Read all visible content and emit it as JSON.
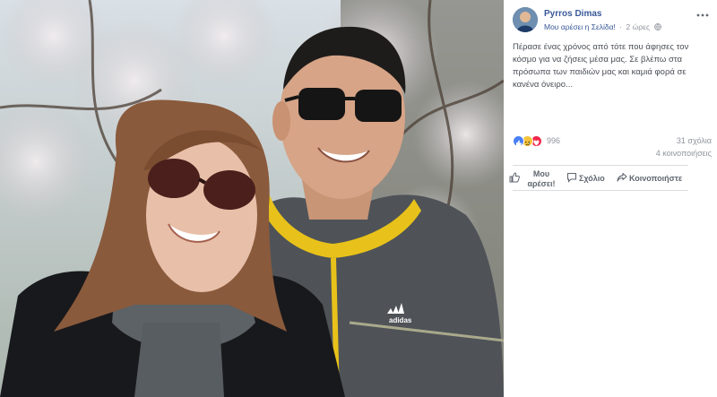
{
  "post": {
    "author": "Pyrros Dimas",
    "like_page": "Μου αρέσει η Σελίδα!",
    "separator": "·",
    "time": "2 ώρες",
    "text": "Πέρασε ένας χρόνος από τότε που άφησες τον κόσμο για να ζήσεις μέσα μας. Σε βλέπω στα πρόσωπα των παιδιών μας και καμιά φορά σε κανένα όνειρο..."
  },
  "stats": {
    "reactions_count": "996",
    "comments": "31 σχόλια",
    "shares": "4 κοινοποιήσεις"
  },
  "actions": {
    "like": "Μου αρέσει!",
    "comment": "Σχόλιο",
    "share": "Κοινοποιήστε"
  },
  "photo": {
    "shirt_logo": "adidas"
  },
  "colors": {
    "link": "#385898",
    "meta": "#90949c",
    "text": "#4b4f56",
    "like_reaction": "#4a80f5",
    "love_reaction": "#f0284a",
    "sad_reaction": "#f5c33b",
    "hoodie_yellow": "#e8c21a"
  },
  "icons": {
    "privacy": "globe-icon",
    "options": "more-options-icon",
    "like": "thumbs-up-icon",
    "comment": "speech-bubble-icon",
    "share": "share-arrow-icon"
  }
}
